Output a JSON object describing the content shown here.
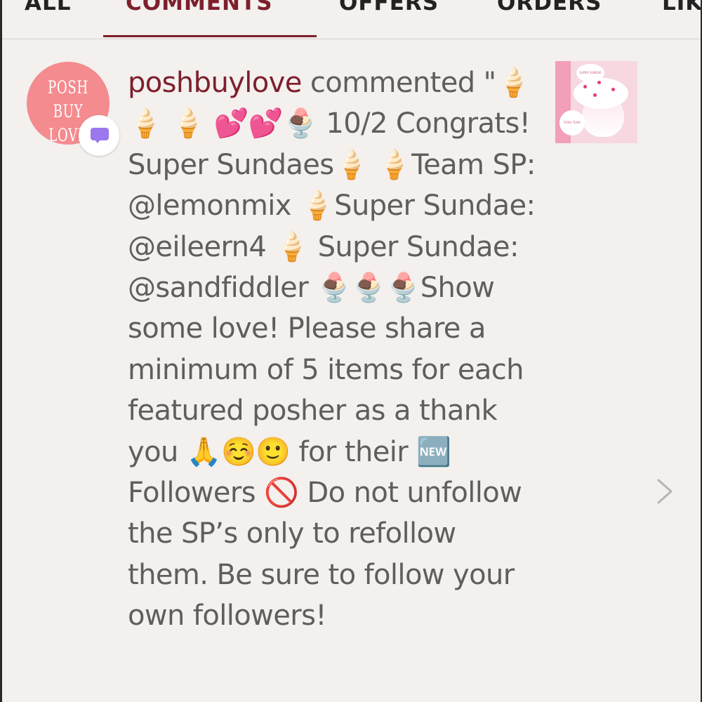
{
  "tabs": [
    {
      "label": "ALL",
      "active": false
    },
    {
      "label": "COMMENTS",
      "active": true
    },
    {
      "label": "OFFERS",
      "active": false
    },
    {
      "label": "ORDERS",
      "active": false
    },
    {
      "label": "LIK",
      "active": false
    }
  ],
  "notification": {
    "avatar_text": [
      "POSH",
      "BUY LOVE"
    ],
    "username": "poshbuylove",
    "action": " commented",
    "comment_text": "\"🍦 🍦 🍦 💕💕🍨 10/2 Congrats! Super Sundaes🍦 🍦Team SP: @lemonmix 🍦Super Sundae: @eileern4 🍦 Super Sundae: @sandfiddler 🍨🍨🍨Show some love! Please share a minimum of 5 items for each featured posher as a thank you 🙏☺️🙂 for their 🆕 Followers 🚫 Do not unfollow the SP’s only to refollow them. Be sure to follow your own followers!",
    "thumbnail_tag": "SUPER SUNDAE",
    "thumbnail_caption": "POSH TEAM PARTY"
  },
  "icons": {
    "badge": "comment-bubble-icon",
    "chevron": "chevron-right-icon"
  },
  "colors": {
    "accent": "#7d1f2c",
    "text": "#5e5e5e",
    "background": "#f3f0ee",
    "avatar": "#f48b8f",
    "badge_bubble": "#9b78ee"
  }
}
